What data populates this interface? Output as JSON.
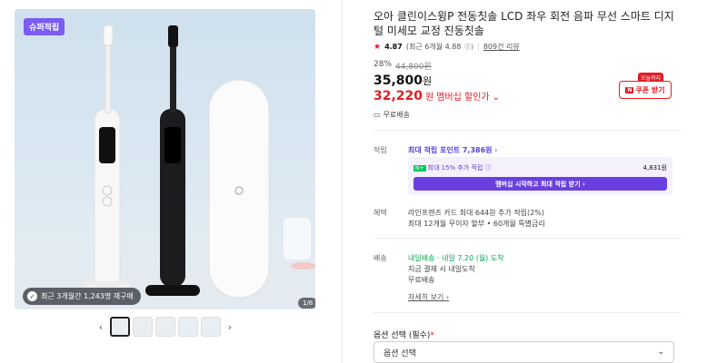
{
  "gallery": {
    "badge": "슈퍼적립",
    "recent_purchase": "최근 3개월간 1,243명 재구매",
    "page_indicator": "1/8",
    "thumbnail_count": 5
  },
  "product": {
    "title": "오아 클린이스윙P 전동칫솔 LCD 좌우 회전 음파 무선 스마트 디지털 미세모 교정 진동칫솔",
    "rating": "4.87",
    "rating_recent": "(최근 6개월 4.88",
    "review_count": "809건 리뷰",
    "discount_pct": "28%",
    "original_price": "44,800원",
    "price": "35,800",
    "price_unit": "원",
    "member_price": "32,220",
    "member_price_unit": "원",
    "member_price_label": "멤버십 할인가",
    "shipping_free": "무료배송"
  },
  "coupon": {
    "today_tag": "오늘까지",
    "label": "쿠폰 받기",
    "icon_letter": "N"
  },
  "points": {
    "label": "적립",
    "max_points": "최대 적립 포인트 7,386원",
    "extra_label": "최대 15% 추가 적립",
    "extra_amount": "4,831원",
    "membership_button": "멤버십 시작하고 최대 적립 받기"
  },
  "benefit": {
    "label": "혜택",
    "line1": "라인프렌즈 카드 최대 644원 추가 적립(2%)",
    "line2": "최대 12개월 무이자 할부 • 60개월 특별금리"
  },
  "delivery": {
    "label": "배송",
    "tomorrow": "내일배송",
    "date": "· 내일 7.20 (월) 도착",
    "line2": "지금 결제 시 내일도착",
    "line3": "무료배송",
    "detail_link": "자세히 보기"
  },
  "options": {
    "label": "옵션 선택 (필수)",
    "required_mark": "*",
    "placeholder": "옵션 선택"
  }
}
